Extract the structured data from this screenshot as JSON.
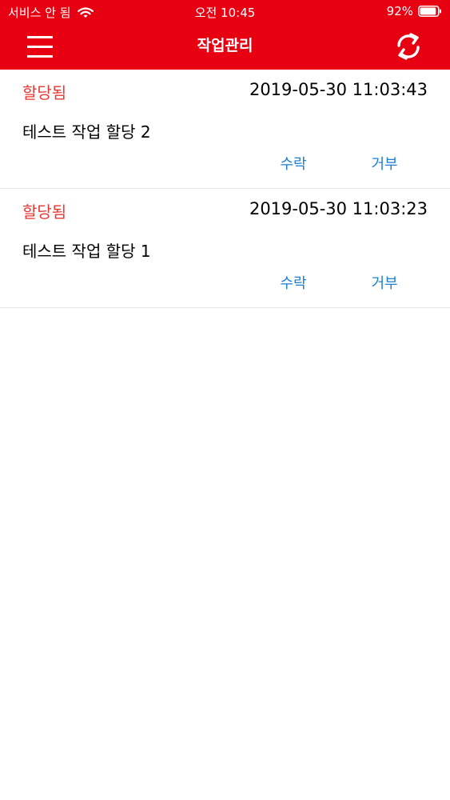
{
  "status_bar": {
    "carrier": "서비스 안 됨",
    "time": "오전 10:45",
    "battery": "92%",
    "battery_level": 0.92
  },
  "header": {
    "title": "작업관리",
    "menu_icon": "hamburger-menu-icon",
    "refresh_icon": "refresh-icon",
    "background_color": "#e60012"
  },
  "tasks": [
    {
      "status": "할당됨",
      "date": "2019-05-30 11:03:43",
      "title": "테스트 작업 할당 2",
      "accept_label": "수락",
      "reject_label": "거부"
    },
    {
      "status": "할당됨",
      "date": "2019-05-30 11:03:23",
      "title": "테스트 작업 할당 1",
      "accept_label": "수락",
      "reject_label": "거부"
    }
  ],
  "colors": {
    "status_text": "#e53935",
    "action_text": "#1a7fd1"
  }
}
